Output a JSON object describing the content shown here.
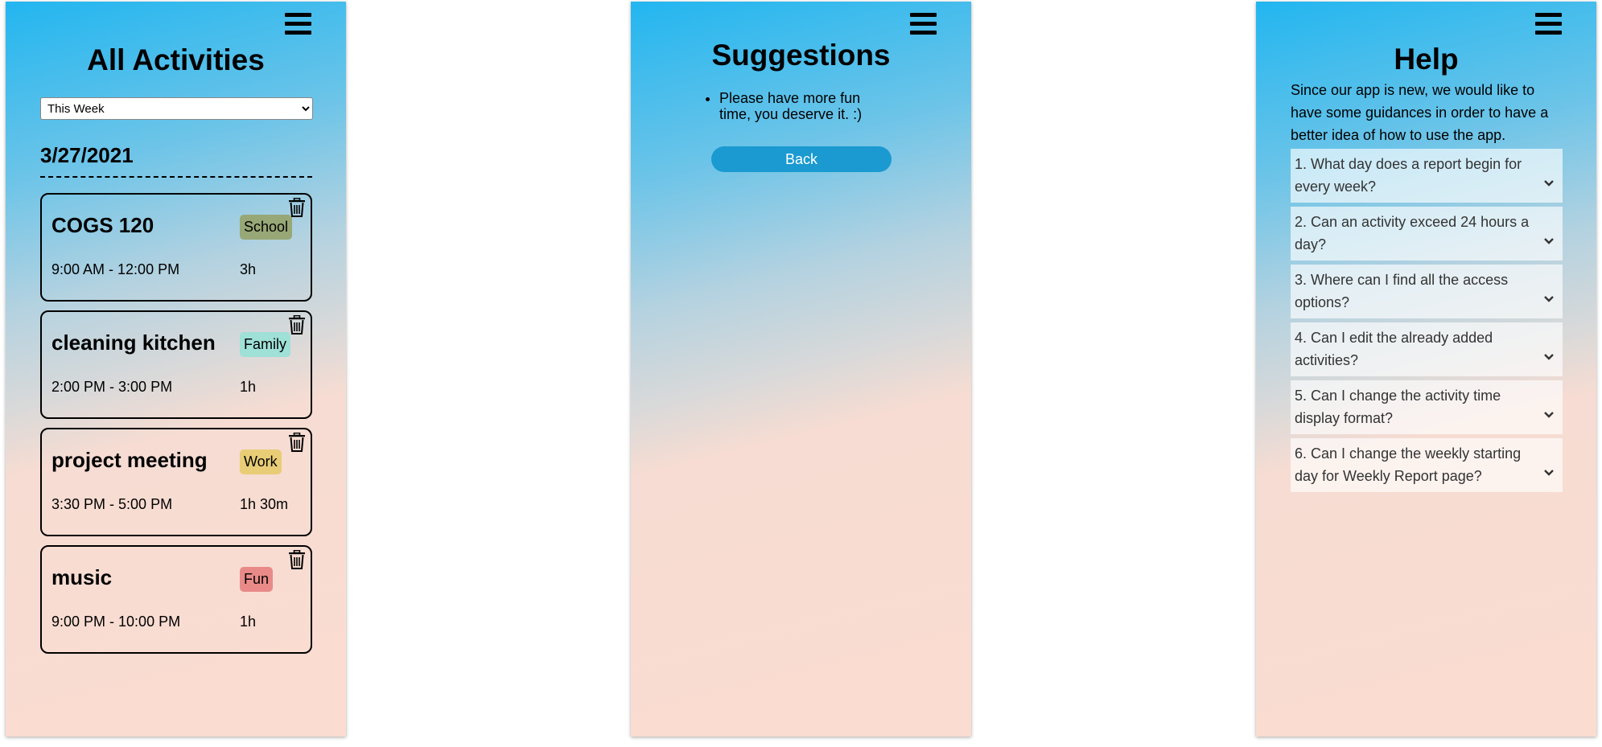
{
  "activities_screen": {
    "title": "All Activities",
    "week_filter": {
      "selected": "This Week"
    },
    "date": "3/27/2021",
    "activities": [
      {
        "name": "COGS 120",
        "category": "School",
        "category_color": "#97a776",
        "time": "9:00 AM - 12:00 PM",
        "duration": "3h"
      },
      {
        "name": "cleaning kitchen",
        "category": "Family",
        "category_color": "#9fe0d7",
        "time": "2:00 PM - 3:00 PM",
        "duration": "1h"
      },
      {
        "name": "project meeting",
        "category": "Work",
        "category_color": "#e8cd76",
        "time": "3:30 PM - 5:00 PM",
        "duration": "1h 30m"
      },
      {
        "name": "music",
        "category": "Fun",
        "category_color": "#e98a88",
        "time": "9:00 PM - 10:00 PM",
        "duration": "1h"
      }
    ],
    "icons": {
      "menu": "hamburger-menu-icon",
      "delete": "trash-icon"
    }
  },
  "suggestions_screen": {
    "title": "Suggestions",
    "items": [
      "Please have more fun time, you deserve it. :)"
    ],
    "back_label": "Back",
    "button_color": "#1a9ad0"
  },
  "help_screen": {
    "title": "Help",
    "intro": "Since our app is new, we would like to have some guidances in order to have a better idea of how to use the app.",
    "faqs": [
      "1. What day does a report begin for every week?",
      "2. Can an activity exceed 24 hours a day?",
      "3. Where can I find all the access options?",
      "4. Can I edit the already added activities?",
      "5. Can I change the activity time display format?",
      "6. Can I change the weekly starting day for Weekly Report page?"
    ],
    "icons": {
      "expand": "chevron-down-icon"
    }
  },
  "theme": {
    "gradient_top": "#22b6f0",
    "gradient_bottom": "#fbdcd1"
  }
}
